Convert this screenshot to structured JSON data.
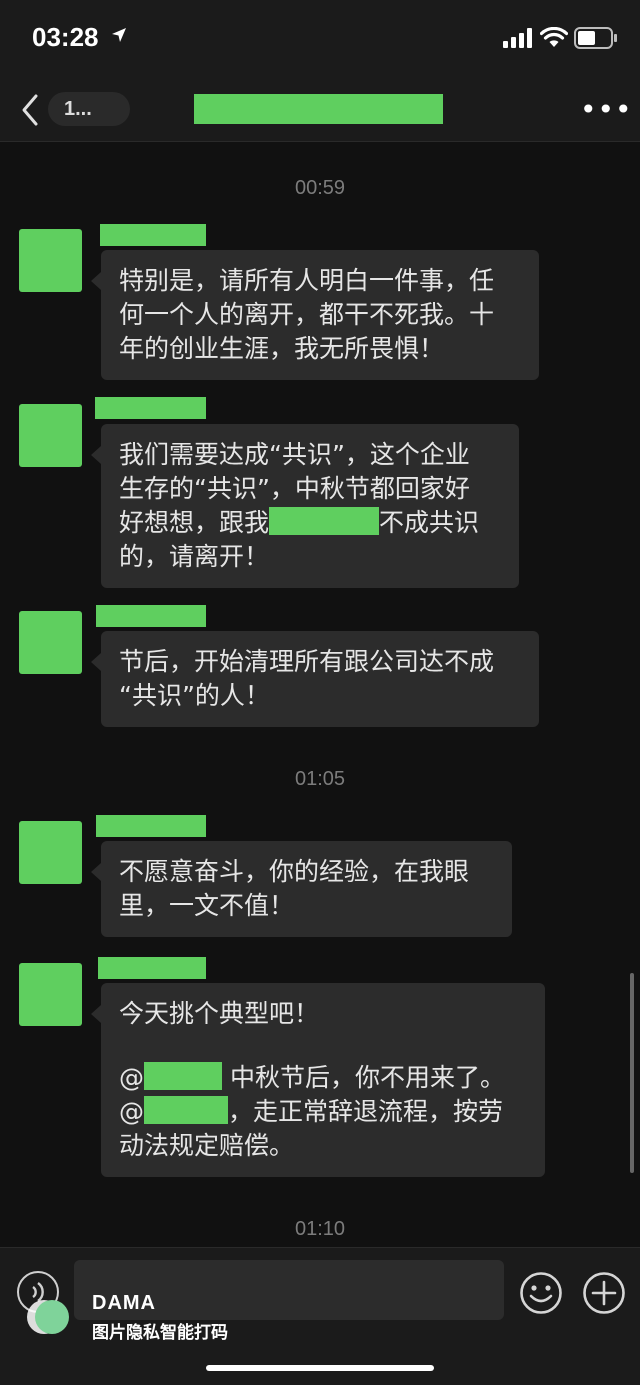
{
  "status_bar": {
    "time": "03:28"
  },
  "nav": {
    "back_count": "1...",
    "more": "•••"
  },
  "timestamps": [
    "00:59",
    "01:05",
    "01:10"
  ],
  "messages": [
    {
      "text": "特别是，请所有人明白一件事，任\n何一个人的离开，都干不死我。十\n年的创业生涯，我无所畏惧！"
    },
    {
      "line1": "我们需要达成“共识”，这个企业",
      "line2": "生存的“共识”，中秋节都回家好",
      "line3a": "好想想，跟我",
      "line3b": "不成共识",
      "line4": "的，请离开！"
    },
    {
      "text": "节后，开始清理所有跟公司达不成\n“共识”的人！"
    },
    {
      "text": "不愿意奋斗，你的经验，在我眼\n里，一文不值！"
    },
    {
      "line1": "今天挑个典型吧！",
      "at1_prefix": "@",
      "at1_suffix": " 中秋节后，你不用来了。",
      "at2_prefix": "@",
      "at2_suffix": "，走正常辞退流程，按劳",
      "line4": "动法规定赔偿。"
    }
  ],
  "watermark": {
    "title": "DAMA",
    "subtitle": "图片隐私智能打码"
  },
  "colors": {
    "mask_green": "#5fcf5f",
    "bubble": "#2c2c2c",
    "background": "#111111"
  }
}
